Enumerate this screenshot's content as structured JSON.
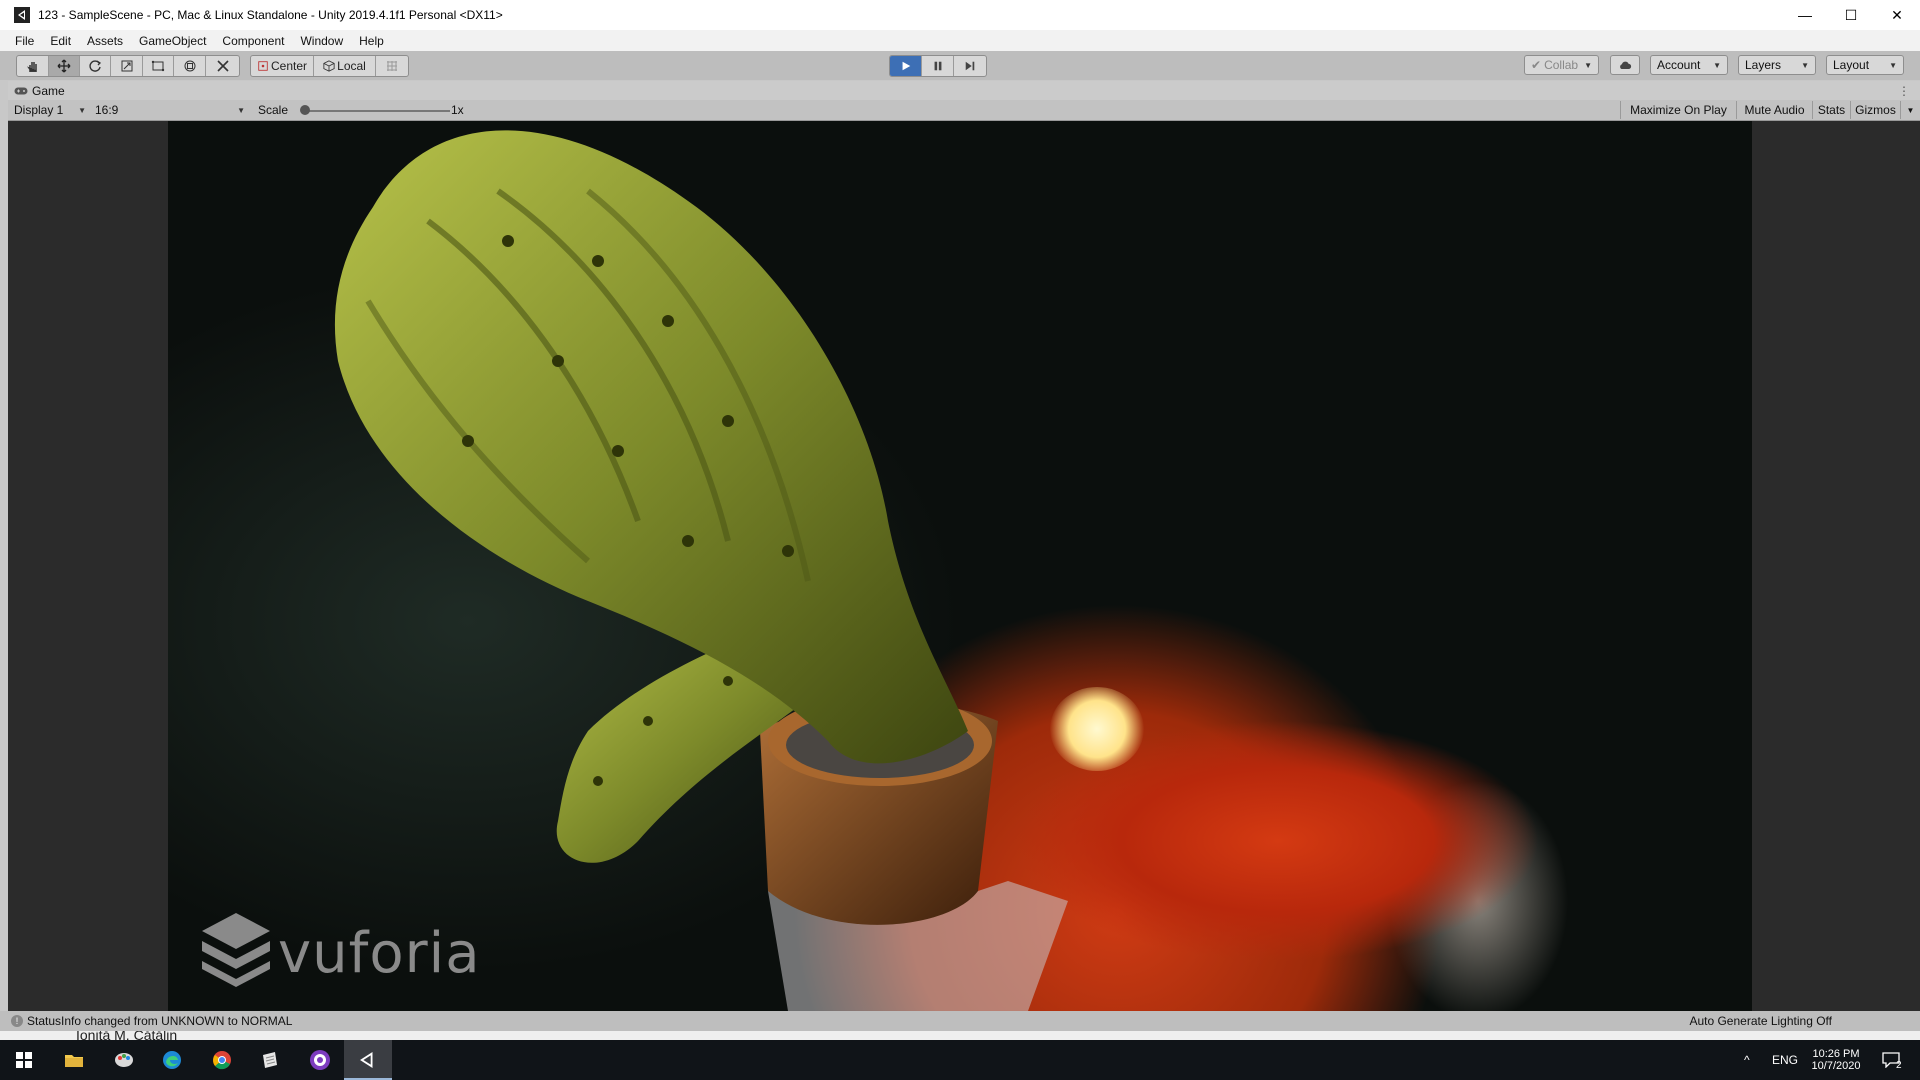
{
  "window": {
    "title": "123 - SampleScene - PC, Mac & Linux Standalone - Unity 2019.4.1f1 Personal <DX11>",
    "controls": {
      "minimize": "—",
      "maximize": "☐",
      "close": "✕"
    }
  },
  "menu": [
    "File",
    "Edit",
    "Assets",
    "GameObject",
    "Component",
    "Window",
    "Help"
  ],
  "toolbar": {
    "pivot_label": "Center",
    "space_label": "Local",
    "collab_label": "Collab",
    "account_label": "Account",
    "layers_label": "Layers",
    "layout_label": "Layout",
    "play_state": "playing",
    "accent": "#3d6fb5"
  },
  "game_panel": {
    "tab_label": "Game",
    "display_value": "Display 1",
    "aspect_value": "16:9",
    "scale_label": "Scale",
    "scale_value": "1x",
    "scale_level": 0,
    "maximize_label": "Maximize On Play",
    "mute_label": "Mute Audio",
    "stats_label": "Stats",
    "gizmos_label": "Gizmos"
  },
  "viewport": {
    "watermark": "vuforia"
  },
  "status": {
    "message": "StatusInfo changed from UNKNOWN to NORMAL",
    "lighting": "Auto Generate Lighting Off"
  },
  "background_window": {
    "text": "Ioniță M. Cătălin"
  },
  "taskbar": {
    "apps": [
      "start-icon",
      "file-explorer-icon",
      "paint-icon",
      "edge-icon",
      "chrome-icon",
      "notepad-icon",
      "app-icon",
      "unity-icon"
    ],
    "language": "ENG",
    "time": "10:26 PM",
    "date": "10/7/2020",
    "notification_count": "2"
  }
}
